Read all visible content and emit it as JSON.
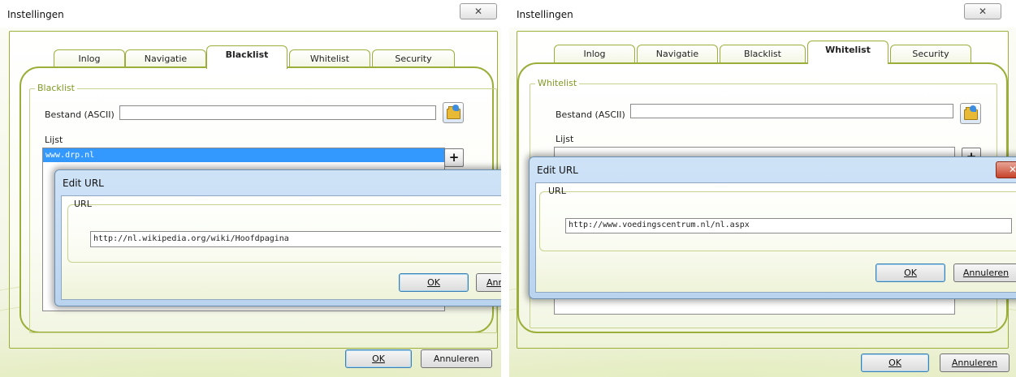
{
  "left": {
    "window_title": "Instellingen",
    "close_glyph": "✕",
    "tabs": [
      "Inlog",
      "Navigatie",
      "Blacklist",
      "Whitelist",
      "Security"
    ],
    "active_tab": "Blacklist",
    "group_title": "Blacklist",
    "file_label": "Bestand (ASCII)",
    "file_value": "",
    "list_label": "Lijst",
    "list_items": [
      "www.drp.nl"
    ],
    "add_glyph": "+",
    "ok_label": "OK",
    "cancel_label": "Annuleren",
    "dialog": {
      "title": "Edit URL",
      "group_title": "URL",
      "url_value": "http://nl.wikipedia.org/wiki/Hoofdpagina",
      "ok_label": "OK",
      "cancel_label": "Ann"
    }
  },
  "right": {
    "window_title": "Instellingen",
    "close_glyph": "✕",
    "tabs": [
      "Inlog",
      "Navigatie",
      "Blacklist",
      "Whitelist",
      "Security"
    ],
    "active_tab": "Whitelist",
    "group_title": "Whitelist",
    "file_label": "Bestand (ASCII)",
    "file_value": "",
    "list_label": "Lijst",
    "add_glyph": "+",
    "ok_label": "OK",
    "cancel_label": "Annuleren",
    "dialog": {
      "title": "Edit URL",
      "group_title": "URL",
      "url_value": "http://www.voedingscentrum.nl/nl.aspx",
      "ok_label": "OK",
      "cancel_label": "Annuleren",
      "close_glyph": "✕"
    }
  },
  "colors": {
    "frame_green": "#9cae3a",
    "group_title_green": "#7f9a22",
    "selection_blue": "#3399ff",
    "dialog_frame_blue": "#b9d3ef",
    "dialog_close_red": "#c7432a"
  },
  "icons": {
    "open_file": "folder-open-icon",
    "add": "plus-icon",
    "close": "close-icon"
  }
}
